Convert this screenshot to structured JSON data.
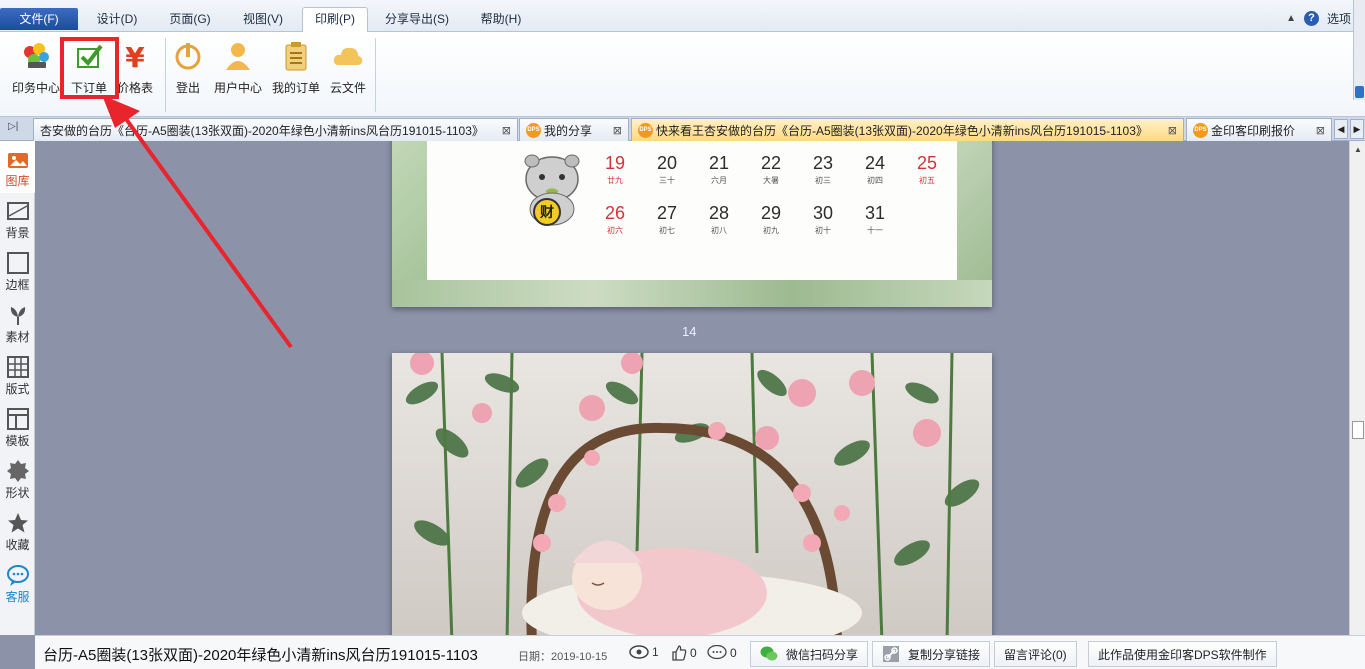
{
  "menubar": {
    "file": "文件(F)",
    "items": [
      "设计(D)",
      "页面(G)",
      "视图(V)",
      "印刷(P)",
      "分享导出(S)",
      "帮助(H)"
    ],
    "options": "选项"
  },
  "ribbon": {
    "print_center": "印务中心",
    "place_order": "下订单",
    "price_list": "价格表",
    "logout": "登出",
    "user_center": "用户中心",
    "my_orders": "我的订单",
    "cloud_files": "云文件"
  },
  "tabs": [
    {
      "label": "杏安做的台历《台历-A5圈装(13张双面)-2020年绿色小清新ins风台历191015-1103》",
      "active": false
    },
    {
      "label": "我的分享",
      "active": false
    },
    {
      "label": "快来看王杏安做的台历《台历-A5圈装(13张双面)-2020年绿色小清新ins风台历191015-1103》",
      "active": true
    },
    {
      "label": "金印客印刷报价",
      "active": false
    }
  ],
  "sidebar": {
    "items": [
      "图库",
      "背景",
      "边框",
      "素材",
      "版式",
      "模板",
      "形状",
      "收藏",
      "客服"
    ]
  },
  "calendar": {
    "coin_char": "财",
    "rows": [
      [
        {
          "d": "19",
          "l": "廿九",
          "red": true
        },
        {
          "d": "20",
          "l": "三十",
          "red": false
        },
        {
          "d": "21",
          "l": "六月",
          "red": false
        },
        {
          "d": "22",
          "l": "大暑",
          "red": false
        },
        {
          "d": "23",
          "l": "初三",
          "red": false
        },
        {
          "d": "24",
          "l": "初四",
          "red": false
        },
        {
          "d": "25",
          "l": "初五",
          "red": true
        }
      ],
      [
        {
          "d": "26",
          "l": "初六",
          "red": true
        },
        {
          "d": "27",
          "l": "初七",
          "red": false
        },
        {
          "d": "28",
          "l": "初八",
          "red": false
        },
        {
          "d": "29",
          "l": "初九",
          "red": false
        },
        {
          "d": "30",
          "l": "初十",
          "red": false
        },
        {
          "d": "31",
          "l": "十一",
          "red": false
        }
      ]
    ]
  },
  "page_number": "14",
  "status": {
    "title": "台历-A5圈装(13张双面)-2020年绿色小清新ins风台历191015-1103",
    "date": "日期：2019-10-15",
    "views": "1",
    "likes": "0",
    "comments": "0",
    "wechat_share": "微信扫码分享",
    "copy_link": "复制分享链接",
    "leave_comment": "留言评论(0)",
    "made_with": "此作品使用金印客DPS软件制作"
  },
  "colors": {
    "accent_blue": "#1d4c9e",
    "highlight_red": "#e8242c",
    "active_tab": "#ffd982",
    "canvas_bg": "#8c93a9"
  },
  "icons": {
    "print_center": "printer-colorful-icon",
    "place_order": "green-check-icon",
    "price_list": "yen-icon",
    "logout": "power-icon",
    "user_center": "user-icon",
    "my_orders": "clipboard-icon",
    "cloud_files": "cloud-icon"
  }
}
